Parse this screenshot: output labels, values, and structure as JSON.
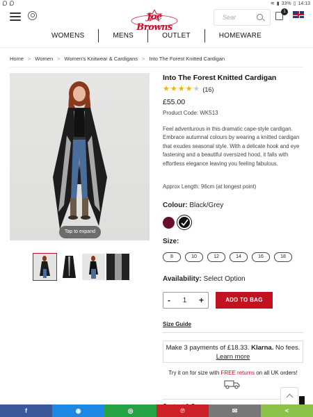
{
  "status_bar": {
    "battery": "33%",
    "time": "14:13"
  },
  "header": {
    "logo_text": "Joe Browns",
    "search_placeholder": "Sear",
    "bag_count": "1"
  },
  "nav": {
    "items": [
      "WOMENS",
      "MENS",
      "OUTLET",
      "HOMEWARE"
    ]
  },
  "breadcrumb": [
    "Home",
    "Women",
    "Women's Knitwear & Cardigans",
    "Into The Forest Knitted Cardigan"
  ],
  "gallery": {
    "tap_label": "Tap to expand"
  },
  "product": {
    "title": "Into The Forest Knitted Cardigan",
    "rating_count": "(16)",
    "stars_filled": 4,
    "price": "£55.00",
    "code": "Product Code: WK513",
    "description": "Feel adventurous in this dramatic cape-style cardigan. Embrace autumnal colours by wearing a knitted cardigan that exudes seasonal style. With a delicate hook and eye fastening and a beautiful oversized hood, it falls with effortless elegance leaving you feeling fabulous.",
    "approx_length": "Approx Length: 96cm (at longest point)",
    "colour_label": "Colour:",
    "colour_value": "Black/Grey",
    "size_label": "Size:",
    "sizes": [
      "8",
      "10",
      "12",
      "14",
      "16",
      "18"
    ],
    "availability_label": "Availability:",
    "availability_value": "Select Option",
    "quantity": "1",
    "add_to_bag": "ADD TO BAG",
    "size_guide": "Size Guide",
    "klarna_line1": "Make 3 payments of £18.33.",
    "klarna_brand": "Klarna.",
    "klarna_line2": "No fees.",
    "klarna_link": "Learn more",
    "returns_pre": "Try it on for size with ",
    "returns_free": "FREE returns",
    "returns_post": " on all UK orders!",
    "content_care": "Content & Care"
  },
  "colors": {
    "brand_red": "#c2121f",
    "swatch_wine": "#6a0f2b",
    "swatch_black": "#111111",
    "share_facebook": "#3b5998",
    "share_messenger": "#1e88e5",
    "share_whatsapp": "#25a244",
    "share_pinterest": "#cb2027",
    "share_email": "#777777",
    "share_generic": "#8bc34a"
  },
  "share_bar": {
    "facebook": "f",
    "messenger": "◉",
    "whatsapp": "◎",
    "pinterest": "℗",
    "email": "✉",
    "share": "<"
  }
}
